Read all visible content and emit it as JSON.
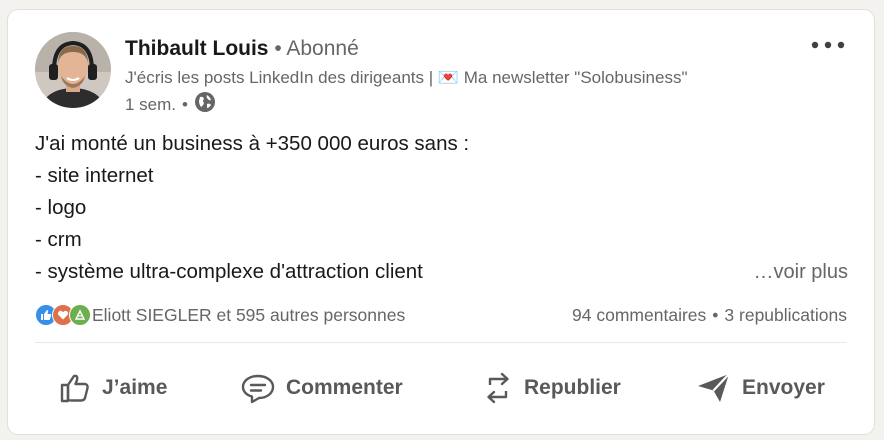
{
  "author": {
    "name": "Thibault Louis",
    "separator": "•",
    "follow_status": "Abonné",
    "headline": "J'écris les posts LinkedIn des dirigeants | 💌 Ma newsletter \"Solobusiness\"",
    "headline_icon": "envelope-heart-icon",
    "time": "1 sem.",
    "visibility_icon": "globe-icon"
  },
  "post": {
    "lines": [
      "J'ai monté un business à +350 000 euros sans :",
      "- site internet",
      "- logo",
      "- crm",
      "- système ultra-complexe d'attraction client"
    ],
    "see_more": "…voir plus"
  },
  "social": {
    "reactions_icons": [
      "like-icon",
      "love-icon",
      "support-icon"
    ],
    "reactions_text": "Eliott SIEGLER et 595 autres personnes",
    "comments": "94 commentaires",
    "separator": "•",
    "reposts": "3 republications"
  },
  "actions": {
    "like": "J’aime",
    "comment": "Commenter",
    "repost": "Republier",
    "send": "Envoyer"
  },
  "colors": {
    "text": "#191919",
    "muted": "#666666",
    "action": "#595959",
    "like_blue": "#378fe9",
    "love_red": "#df704d",
    "support_green": "#6dae4f"
  }
}
